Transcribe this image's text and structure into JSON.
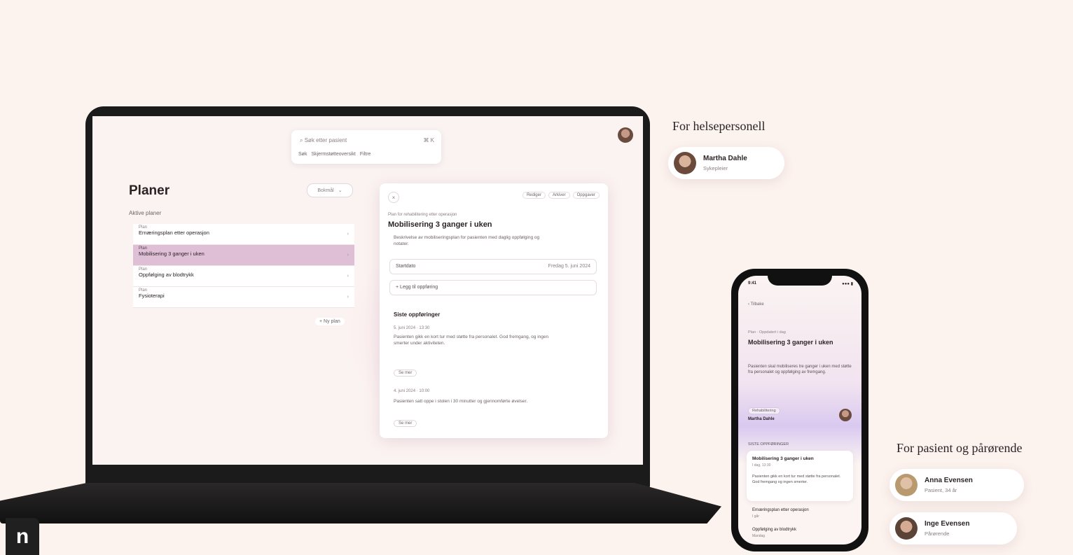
{
  "laptop": {
    "search": {
      "placeholder": "Søk etter pasient",
      "shortcut": "⌘ K",
      "chips": [
        "Søk",
        "Skjermstøtteoversikt",
        "Filtre"
      ]
    },
    "plans": {
      "title": "Planer",
      "subtitle": "Aktive planer",
      "language_button": "Bokmål",
      "items": [
        {
          "meta": "Plan",
          "title": "Ernæringsplan etter operasjon"
        },
        {
          "meta": "Plan",
          "title": "Mobilisering 3 ganger i uken"
        },
        {
          "meta": "Plan",
          "title": "Oppfølging av blodtrykk"
        },
        {
          "meta": "Plan",
          "title": "Fysioterapi"
        }
      ],
      "new_plan": "+ Ny plan"
    },
    "detail": {
      "close": "×",
      "actions": [
        "Rediger",
        "Arkiver",
        "Oppgaver"
      ],
      "meta": "Plan for rehabilitering etter operasjon",
      "title": "Mobilisering 3 ganger i uken",
      "description": "Beskrivelse av mobiliseringsplan for pasienten med daglig oppfølging og notater.",
      "field_date_label": "Startdato",
      "field_date_value": "Fredag 5. juni 2024",
      "field_note": "Legg til oppføring",
      "section": "Siste oppføringer",
      "entries": [
        {
          "time": "5. juni 2024 · 13:30",
          "text": "Pasienten gikk en kort tur med støtte fra personalet. God fremgang, og ingen smerter under aktiviteten.",
          "pill": "Se mer"
        },
        {
          "time": "4. juni 2024 · 10:00",
          "text": "Pasienten satt oppe i stolen i 30 minutter og gjennomførte øvelser.",
          "pill": "Se mer"
        }
      ]
    }
  },
  "phone": {
    "time": "9:41",
    "status": "●●● ▮",
    "back": "‹ Tilbake",
    "meta": "Plan · Oppdatert i dag",
    "title": "Mobilisering 3 ganger i uken",
    "description": "Pasienten skal mobiliseres tre ganger i uken med støtte fra personalet og oppfølging av fremgang.",
    "tag": "Rehabilitering",
    "by": "Martha Dahle",
    "section": "SISTE OPPFØRINGER",
    "card": {
      "title": "Mobilisering 3 ganger i uken",
      "sub": "I dag, 13:30",
      "text": "Pasienten gikk en kort tur med støtte fra personalet. God fremgang og ingen smerter."
    },
    "rows": [
      {
        "title": "Ernæringsplan etter operasjon",
        "sub": "I går"
      },
      {
        "title": "Oppfølging av blodtrykk",
        "sub": "Mandag"
      }
    ]
  },
  "personas": {
    "staff_heading": "For helsepersonell",
    "staff": [
      {
        "name": "Martha Dahle",
        "role": "Sykepleier"
      }
    ],
    "patient_heading": "For pasient og pårørende",
    "patients": [
      {
        "name": "Anna Evensen",
        "role": "Pasient, 34 år"
      },
      {
        "name": "Inge Evensen",
        "role": "Pårørende"
      }
    ]
  },
  "corner_badge": "n"
}
